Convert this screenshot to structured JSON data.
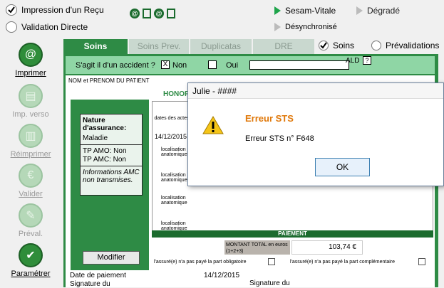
{
  "top": {
    "impression": "Impression d'un Reçu",
    "validation": "Validation Directe",
    "sesam": "Sesam-Vitale",
    "degrade": "Dégradé",
    "desync": "Désynchronisé"
  },
  "left_buttons": [
    "Imprimer",
    "Imp. verso",
    "Réimprimer",
    "Valider",
    "Préval.",
    "Paramétrer"
  ],
  "tabs": [
    "Soins",
    "Soins Prev.",
    "Duplicatas",
    "DRE"
  ],
  "tab_soins_radio": "Soins",
  "tab_preval_radio": "Prévalidations",
  "accident": {
    "question": "S'agit il d'un accident ?",
    "non": "Non",
    "oui": "Oui",
    "ald": "ALD",
    "ald_help": "?"
  },
  "patient_label": "NOM et PRENOM DU PATIENT",
  "honor_label": "HONOR",
  "insurance": {
    "nature": "Nature d'assurance:",
    "maladie": "Maladie",
    "tp_amo": "TP AMO: Non",
    "tp_amc": "TP AMC: Non",
    "info": "Informations AMC non transmises."
  },
  "modifier": "Modifier",
  "form": {
    "dates_label": "dates des actes",
    "date_row": "14/12/2015",
    "localisation": "localisation anatomique",
    "paiement": "PAIEMENT",
    "montant": "MONTANT TOTAL en euros (1+2+3)",
    "montant_value": "103,74 €",
    "obligatoire": "l'assuré(e) n'a pas payé la part obligatoire",
    "complementaire": "l'assuré(e) n'a pas payé la part complémentaire",
    "date_paiement": "Date de paiement",
    "date_paiement_value": "14/12/2015",
    "signature": "Signature du",
    "signature2": "Signature du"
  },
  "dialog": {
    "title": "Julie - ####",
    "heading": "Erreur STS",
    "message": "Erreur STS n° F648",
    "ok": "OK"
  }
}
